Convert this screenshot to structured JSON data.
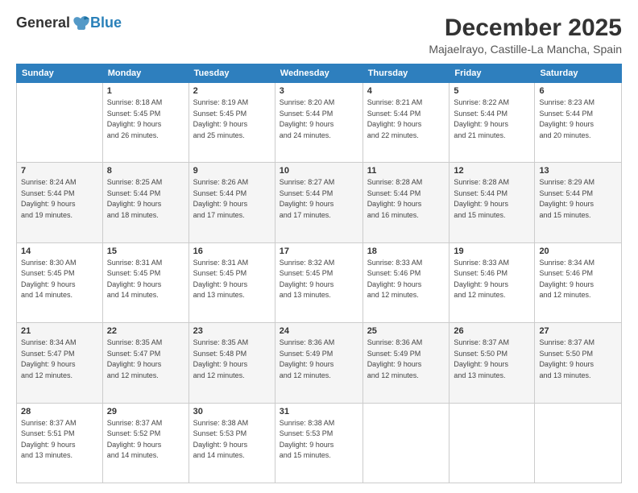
{
  "logo": {
    "general": "General",
    "blue": "Blue"
  },
  "header": {
    "title": "December 2025",
    "location": "Majaelrayo, Castille-La Mancha, Spain"
  },
  "weekdays": [
    "Sunday",
    "Monday",
    "Tuesday",
    "Wednesday",
    "Thursday",
    "Friday",
    "Saturday"
  ],
  "weeks": [
    [
      {
        "day": "",
        "info": ""
      },
      {
        "day": "1",
        "info": "Sunrise: 8:18 AM\nSunset: 5:45 PM\nDaylight: 9 hours\nand 26 minutes."
      },
      {
        "day": "2",
        "info": "Sunrise: 8:19 AM\nSunset: 5:45 PM\nDaylight: 9 hours\nand 25 minutes."
      },
      {
        "day": "3",
        "info": "Sunrise: 8:20 AM\nSunset: 5:44 PM\nDaylight: 9 hours\nand 24 minutes."
      },
      {
        "day": "4",
        "info": "Sunrise: 8:21 AM\nSunset: 5:44 PM\nDaylight: 9 hours\nand 22 minutes."
      },
      {
        "day": "5",
        "info": "Sunrise: 8:22 AM\nSunset: 5:44 PM\nDaylight: 9 hours\nand 21 minutes."
      },
      {
        "day": "6",
        "info": "Sunrise: 8:23 AM\nSunset: 5:44 PM\nDaylight: 9 hours\nand 20 minutes."
      }
    ],
    [
      {
        "day": "7",
        "info": "Sunrise: 8:24 AM\nSunset: 5:44 PM\nDaylight: 9 hours\nand 19 minutes."
      },
      {
        "day": "8",
        "info": "Sunrise: 8:25 AM\nSunset: 5:44 PM\nDaylight: 9 hours\nand 18 minutes."
      },
      {
        "day": "9",
        "info": "Sunrise: 8:26 AM\nSunset: 5:44 PM\nDaylight: 9 hours\nand 17 minutes."
      },
      {
        "day": "10",
        "info": "Sunrise: 8:27 AM\nSunset: 5:44 PM\nDaylight: 9 hours\nand 17 minutes."
      },
      {
        "day": "11",
        "info": "Sunrise: 8:28 AM\nSunset: 5:44 PM\nDaylight: 9 hours\nand 16 minutes."
      },
      {
        "day": "12",
        "info": "Sunrise: 8:28 AM\nSunset: 5:44 PM\nDaylight: 9 hours\nand 15 minutes."
      },
      {
        "day": "13",
        "info": "Sunrise: 8:29 AM\nSunset: 5:44 PM\nDaylight: 9 hours\nand 15 minutes."
      }
    ],
    [
      {
        "day": "14",
        "info": "Sunrise: 8:30 AM\nSunset: 5:45 PM\nDaylight: 9 hours\nand 14 minutes."
      },
      {
        "day": "15",
        "info": "Sunrise: 8:31 AM\nSunset: 5:45 PM\nDaylight: 9 hours\nand 14 minutes."
      },
      {
        "day": "16",
        "info": "Sunrise: 8:31 AM\nSunset: 5:45 PM\nDaylight: 9 hours\nand 13 minutes."
      },
      {
        "day": "17",
        "info": "Sunrise: 8:32 AM\nSunset: 5:45 PM\nDaylight: 9 hours\nand 13 minutes."
      },
      {
        "day": "18",
        "info": "Sunrise: 8:33 AM\nSunset: 5:46 PM\nDaylight: 9 hours\nand 12 minutes."
      },
      {
        "day": "19",
        "info": "Sunrise: 8:33 AM\nSunset: 5:46 PM\nDaylight: 9 hours\nand 12 minutes."
      },
      {
        "day": "20",
        "info": "Sunrise: 8:34 AM\nSunset: 5:46 PM\nDaylight: 9 hours\nand 12 minutes."
      }
    ],
    [
      {
        "day": "21",
        "info": "Sunrise: 8:34 AM\nSunset: 5:47 PM\nDaylight: 9 hours\nand 12 minutes."
      },
      {
        "day": "22",
        "info": "Sunrise: 8:35 AM\nSunset: 5:47 PM\nDaylight: 9 hours\nand 12 minutes."
      },
      {
        "day": "23",
        "info": "Sunrise: 8:35 AM\nSunset: 5:48 PM\nDaylight: 9 hours\nand 12 minutes."
      },
      {
        "day": "24",
        "info": "Sunrise: 8:36 AM\nSunset: 5:49 PM\nDaylight: 9 hours\nand 12 minutes."
      },
      {
        "day": "25",
        "info": "Sunrise: 8:36 AM\nSunset: 5:49 PM\nDaylight: 9 hours\nand 12 minutes."
      },
      {
        "day": "26",
        "info": "Sunrise: 8:37 AM\nSunset: 5:50 PM\nDaylight: 9 hours\nand 13 minutes."
      },
      {
        "day": "27",
        "info": "Sunrise: 8:37 AM\nSunset: 5:50 PM\nDaylight: 9 hours\nand 13 minutes."
      }
    ],
    [
      {
        "day": "28",
        "info": "Sunrise: 8:37 AM\nSunset: 5:51 PM\nDaylight: 9 hours\nand 13 minutes."
      },
      {
        "day": "29",
        "info": "Sunrise: 8:37 AM\nSunset: 5:52 PM\nDaylight: 9 hours\nand 14 minutes."
      },
      {
        "day": "30",
        "info": "Sunrise: 8:38 AM\nSunset: 5:53 PM\nDaylight: 9 hours\nand 14 minutes."
      },
      {
        "day": "31",
        "info": "Sunrise: 8:38 AM\nSunset: 5:53 PM\nDaylight: 9 hours\nand 15 minutes."
      },
      {
        "day": "",
        "info": ""
      },
      {
        "day": "",
        "info": ""
      },
      {
        "day": "",
        "info": ""
      }
    ]
  ]
}
